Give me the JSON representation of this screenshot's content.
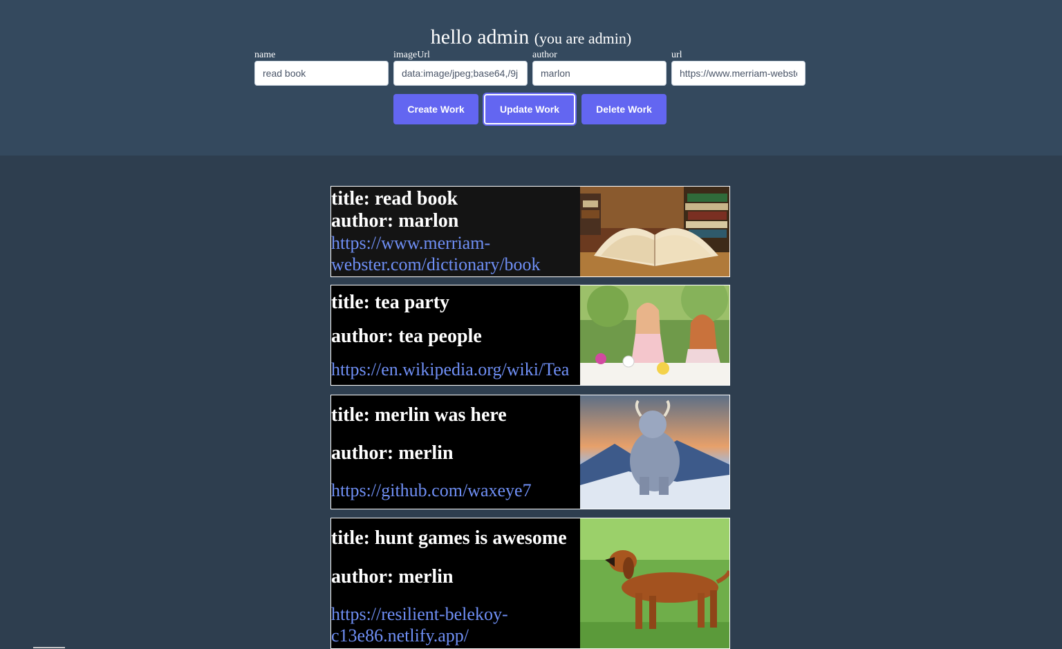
{
  "header": {
    "greeting": "hello admin",
    "role_note": "(you are admin)"
  },
  "form": {
    "name": {
      "label": "name",
      "value": "read book"
    },
    "imageUrl": {
      "label": "imageUrl",
      "value": "data:image/jpeg;base64,/9j"
    },
    "author": {
      "label": "author",
      "value": "marlon"
    },
    "url": {
      "label": "url",
      "value": "https://www.merriam-webster.com/dictionary/book"
    }
  },
  "buttons": {
    "create": "Create Work",
    "update": "Update Work",
    "delete": "Delete Work"
  },
  "works": [
    {
      "title": "title: read book",
      "author": "author: marlon",
      "url": "https://www.merriam-webster.com/dictionary/book",
      "image": "open-book-photo"
    },
    {
      "title": "title: tea party",
      "author": "author: tea people",
      "url": "https://en.wikipedia.org/wiki/Tea",
      "image": "tea-party-photo"
    },
    {
      "title": "title: merlin was here",
      "author": "author: merlin",
      "url": "https://github.com/waxeye7",
      "image": "yeti-photo"
    },
    {
      "title": "title: hunt games is awesome",
      "author": "author: merlin",
      "url": "https://resilient-belekoy-c13e86.netlify.app/",
      "image": "dachshund-photo"
    }
  ],
  "colors": {
    "header_bg": "#34495e",
    "page_bg": "#2e3e4f",
    "button": "#6366f1",
    "link": "#6f8ff5"
  }
}
